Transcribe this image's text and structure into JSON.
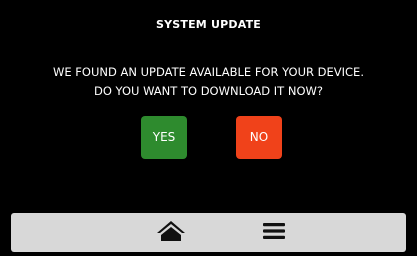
{
  "dialog": {
    "title": "SYSTEM UPDATE",
    "message_lines": [
      "WE FOUND AN UPDATE AVAILABLE FOR YOUR DEVICE.",
      "DO YOU WANT TO DOWNLOAD IT NOW?"
    ],
    "yes_label": "YES",
    "no_label": "NO"
  },
  "colors": {
    "background": "#000000",
    "yes_button": "#2e8b2e",
    "no_button": "#f0421a",
    "navbar": "#d8d8d8",
    "icon": "#111111"
  },
  "navbar": {
    "items": [
      {
        "icon": "home-icon"
      },
      {
        "icon": "menu-icon"
      }
    ]
  }
}
